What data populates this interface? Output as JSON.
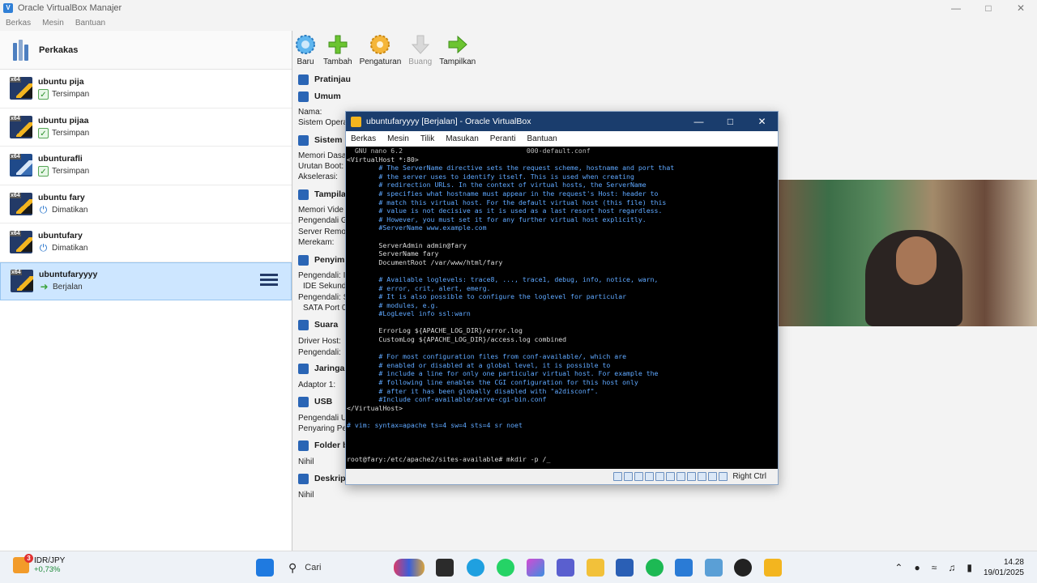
{
  "manager": {
    "title": "Oracle VirtualBox Manajer",
    "menu": [
      "Berkas",
      "Mesin",
      "Bantuan"
    ],
    "tools_label": "Perkakas",
    "vms": [
      {
        "name": "ubuntu pija",
        "status": "Tersimpan",
        "state": "saved"
      },
      {
        "name": "ubuntu pijaa",
        "status": "Tersimpan",
        "state": "saved"
      },
      {
        "name": "ubunturafli",
        "status": "Tersimpan",
        "state": "saved"
      },
      {
        "name": "ubuntu fary",
        "status": "Dimatikan",
        "state": "off"
      },
      {
        "name": "ubuntufary",
        "status": "Dimatikan",
        "state": "off"
      },
      {
        "name": "ubuntufaryyyy",
        "status": "Berjalan",
        "state": "running"
      }
    ],
    "toolbar": {
      "new": "Baru",
      "add": "Tambah",
      "settings": "Pengaturan",
      "discard": "Buang",
      "show": "Tampilkan"
    },
    "details": {
      "preview": "Pratinjau",
      "general": "Umum",
      "general_name": "Nama:",
      "general_os": "Sistem Opera",
      "system": "Sistem",
      "system_memory": "Memori Dasa",
      "system_boot": "Urutan Boot:",
      "system_accel": "Akselerasi:",
      "display": "Tampila",
      "display_memory": "Memori Vide",
      "display_controller": "Pengendali G",
      "display_remote": "Server Remot",
      "display_record": "Merekam:",
      "storage": "Penyimp",
      "storage_ctrl1": "Pengendali: I",
      "storage_ide": "IDE Sekunde",
      "storage_ctrl2": "Pengendali: S",
      "storage_sata": "SATA Port 0",
      "audio": "Suara",
      "audio_host": "Driver Host:",
      "audio_ctrl": "Pengendali:",
      "network": "Jaringar",
      "network_adapter": "Adaptor 1:",
      "usb": "USB",
      "usb_ctrl": "Pengendali U",
      "usb_filter": "Penyaring Pe",
      "shared": "Folder b",
      "shared_value": "Nihil",
      "description": "Deskrips",
      "description_value": "Nihil"
    }
  },
  "vm_window": {
    "title": "ubuntufaryyyy [Berjalan] - Oracle VirtualBox",
    "menu": [
      "Berkas",
      "Mesin",
      "Tilik",
      "Masukan",
      "Peranti",
      "Bantuan"
    ],
    "host_key": "Right Ctrl",
    "terminal_lines": [
      {
        "text": "  GNU nano 6.2                               000-default.conf",
        "cls": "nano"
      },
      {
        "text": "<VirtualHost *:80>",
        "cls": ""
      },
      {
        "text": "        # The ServerName directive sets the request scheme, hostname and port that",
        "cls": "cmt"
      },
      {
        "text": "        # the server uses to identify itself. This is used when creating",
        "cls": "cmt"
      },
      {
        "text": "        # redirection URLs. In the context of virtual hosts, the ServerName",
        "cls": "cmt"
      },
      {
        "text": "        # specifies what hostname must appear in the request's Host: header to",
        "cls": "cmt"
      },
      {
        "text": "        # match this virtual host. For the default virtual host (this file) this",
        "cls": "cmt"
      },
      {
        "text": "        # value is not decisive as it is used as a last resort host regardless.",
        "cls": "cmt"
      },
      {
        "text": "        # However, you must set it for any further virtual host explicitly.",
        "cls": "cmt"
      },
      {
        "text": "        #ServerName www.example.com",
        "cls": "cmt"
      },
      {
        "text": "",
        "cls": ""
      },
      {
        "text": "        ServerAdmin admin@fary",
        "cls": ""
      },
      {
        "text": "        ServerName fary",
        "cls": ""
      },
      {
        "text": "        DocumentRoot /var/www/html/fary",
        "cls": ""
      },
      {
        "text": "",
        "cls": ""
      },
      {
        "text": "        # Available loglevels: trace8, ..., trace1, debug, info, notice, warn,",
        "cls": "cmt"
      },
      {
        "text": "        # error, crit, alert, emerg.",
        "cls": "cmt"
      },
      {
        "text": "        # It is also possible to configure the loglevel for particular",
        "cls": "cmt"
      },
      {
        "text": "        # modules, e.g.",
        "cls": "cmt"
      },
      {
        "text": "        #LogLevel info ssl:warn",
        "cls": "cmt"
      },
      {
        "text": "",
        "cls": ""
      },
      {
        "text": "        ErrorLog ${APACHE_LOG_DIR}/error.log",
        "cls": ""
      },
      {
        "text": "        CustomLog ${APACHE_LOG_DIR}/access.log combined",
        "cls": ""
      },
      {
        "text": "",
        "cls": ""
      },
      {
        "text": "        # For most configuration files from conf-available/, which are",
        "cls": "cmt"
      },
      {
        "text": "        # enabled or disabled at a global level, it is possible to",
        "cls": "cmt"
      },
      {
        "text": "        # include a line for only one particular virtual host. For example the",
        "cls": "cmt"
      },
      {
        "text": "        # following line enables the CGI configuration for this host only",
        "cls": "cmt"
      },
      {
        "text": "        # after it has been globally disabled with \"a2disconf\".",
        "cls": "cmt"
      },
      {
        "text": "        #Include conf-available/serve-cgi-bin.conf",
        "cls": "cmt"
      },
      {
        "text": "</VirtualHost>",
        "cls": ""
      },
      {
        "text": "",
        "cls": ""
      },
      {
        "text": "# vim: syntax=apache ts=4 sw=4 sts=4 sr noet",
        "cls": "cmt"
      },
      {
        "text": "",
        "cls": ""
      },
      {
        "text": "",
        "cls": ""
      },
      {
        "text": "",
        "cls": ""
      },
      {
        "text": "root@fary:/etc/apache2/sites-available# mkdir -p /_",
        "cls": ""
      }
    ]
  },
  "taskbar": {
    "weather_label": "IDR/JPY",
    "weather_value": "+0,73%",
    "weather_badge": "3",
    "search_placeholder": "Cari",
    "time": "14.28",
    "date": "19/01/2025"
  },
  "colors": {
    "vm_titlebar": "#1a3d6d",
    "selection": "#cde6ff",
    "terminal_comment": "#5fa8ff"
  }
}
